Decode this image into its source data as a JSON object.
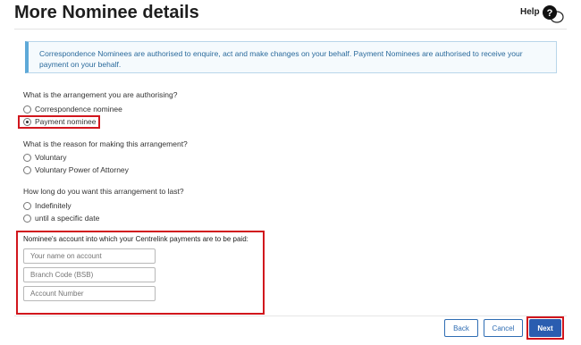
{
  "header": {
    "title": "More Nominee details",
    "help_label": "Help"
  },
  "info": {
    "text": "Correspondence Nominees are authorised to enquire, act and make changes on your behalf. Payment Nominees are authorised to receive your payment on your behalf."
  },
  "arrangement": {
    "question": "What is the arrangement you are authorising?",
    "options": [
      "Correspondence nominee",
      "Payment nominee"
    ],
    "selected": "Payment nominee"
  },
  "reason": {
    "question": "What is the reason for making this arrangement?",
    "options": [
      "Voluntary",
      "Voluntary Power of Attorney"
    ]
  },
  "duration": {
    "question": "How long do you want this arrangement to last?",
    "options": [
      "Indefinitely",
      "until a specific date"
    ]
  },
  "account": {
    "label": "Nominee's account into which your Centrelink payments are to be paid:",
    "name_placeholder": "Your name on account",
    "bsb_placeholder": "Branch Code (BSB)",
    "number_placeholder": "Account Number"
  },
  "footer": {
    "back_label": "Back",
    "cancel_label": "Cancel",
    "next_label": "Next"
  },
  "colors": {
    "highlight": "#d1161d",
    "primary": "#2a5db0",
    "info_text": "#2a6a9c"
  }
}
